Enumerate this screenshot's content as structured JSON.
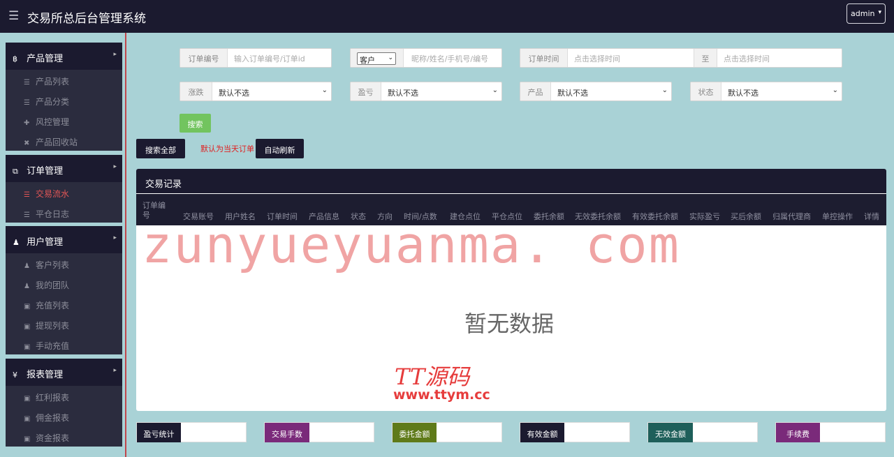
{
  "header": {
    "title": "交易所总后台管理系统",
    "user": "admin"
  },
  "sidebar": {
    "groups": [
      {
        "label": "产品管理",
        "icon": "bitcoin-icon",
        "items": [
          "产品列表",
          "产品分类",
          "风控管理",
          "产品回收站"
        ]
      },
      {
        "label": "订单管理",
        "icon": "copy-icon",
        "items": [
          "交易流水",
          "平仓日志"
        ]
      },
      {
        "label": "用户管理",
        "icon": "user-icon",
        "items": [
          "客户列表",
          "我的团队",
          "充值列表",
          "提现列表",
          "手动充值"
        ]
      },
      {
        "label": "报表管理",
        "icon": "yen-icon",
        "items": [
          "红利报表",
          "佣金报表",
          "资金报表"
        ]
      }
    ]
  },
  "filters": {
    "order_no": {
      "label": "订单编号",
      "placeholder": "输入订单编号/订单id"
    },
    "customer": {
      "selected": "客户",
      "placeholder": "昵称/姓名/手机号/编号"
    },
    "order_time": {
      "label": "订单时间",
      "placeholder": "点击选择时间",
      "to_label": "至",
      "to_placeholder": "点击选择时间"
    },
    "rise_fall": {
      "label": "涨跌",
      "selected": "默认不选"
    },
    "profit": {
      "label": "盈亏",
      "selected": "默认不选"
    },
    "product": {
      "label": "产品",
      "selected": "默认不选"
    },
    "status": {
      "label": "状态",
      "selected": "默认不选"
    },
    "search_label": "搜索"
  },
  "actions": {
    "search_all": "搜索全部",
    "default_note": "默认为当天订单",
    "auto_refresh": "自动刷新"
  },
  "table": {
    "title": "交易记录",
    "columns": [
      "订单编号",
      "交易账号",
      "用户姓名",
      "订单时间",
      "产品信息",
      "状态",
      "方向",
      "时间/点数",
      "建仓点位",
      "平仓点位",
      "委托余额",
      "无效委托余额",
      "有效委托余额",
      "实际盈亏",
      "买后余额",
      "归属代理商",
      "单控操作",
      "详情"
    ],
    "empty_text": "暂无数据",
    "watermark": "zunyueyuanma. com",
    "logo_text": "TT源码",
    "logo_url": "www.ttym.cc"
  },
  "stats": [
    {
      "label": "盈亏统计",
      "color": "#1b1a2f"
    },
    {
      "label": "交易手数",
      "color": "#7a2a7a"
    },
    {
      "label": "委托金额",
      "color": "#5f7a19"
    },
    {
      "label": "有效金额",
      "color": "#1b1a2f"
    },
    {
      "label": "无效金额",
      "color": "#1e5f5a"
    },
    {
      "label": "手续费",
      "color": "#7a2a7a"
    }
  ]
}
